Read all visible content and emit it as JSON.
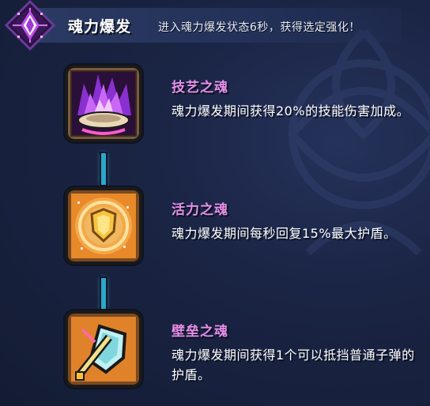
{
  "header": {
    "title": "魂力爆发",
    "description": "进入魂力爆发状态6秒，获得选定强化！",
    "icon": "soul-crystal-icon"
  },
  "upgrades": [
    {
      "title": "技艺之魂",
      "description": "魂力爆发期间获得20%的技能伤害加成。",
      "icon": "purple-soul-flame-icon",
      "accent": "#b34de0"
    },
    {
      "title": "活力之魂",
      "description": "魂力爆发期间每秒回复15%最大护盾。",
      "icon": "golden-shield-icon",
      "accent": "#f0a030"
    },
    {
      "title": "壁垒之魂",
      "description": "魂力爆发期间获得1个可以抵挡普通子弹的护盾。",
      "icon": "barrier-shield-sword-icon",
      "accent": "#e08a2a"
    }
  ],
  "colors": {
    "background": "#151e36",
    "title_pink": "#e58fe8",
    "connector_cyan": "#2aa7c9"
  }
}
